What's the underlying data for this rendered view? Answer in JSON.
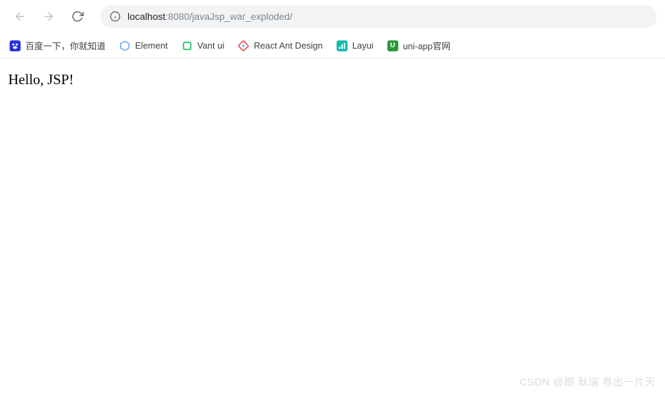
{
  "toolbar": {
    "url_host": "localhost",
    "url_port_path": ":8080/javaJsp_war_exploded/"
  },
  "bookmarks": [
    {
      "label": "百度一下，你就知道",
      "icon": "baidu"
    },
    {
      "label": "Element",
      "icon": "element"
    },
    {
      "label": "Vant ui",
      "icon": "vant"
    },
    {
      "label": "React Ant Design",
      "icon": "react"
    },
    {
      "label": "Layui",
      "icon": "layui"
    },
    {
      "label": "uni-app官网",
      "icon": "uniapp"
    }
  ],
  "page": {
    "heading": "Hello, JSP!"
  },
  "watermark": "CSDN @跟 耿瑞 卷出一片天"
}
